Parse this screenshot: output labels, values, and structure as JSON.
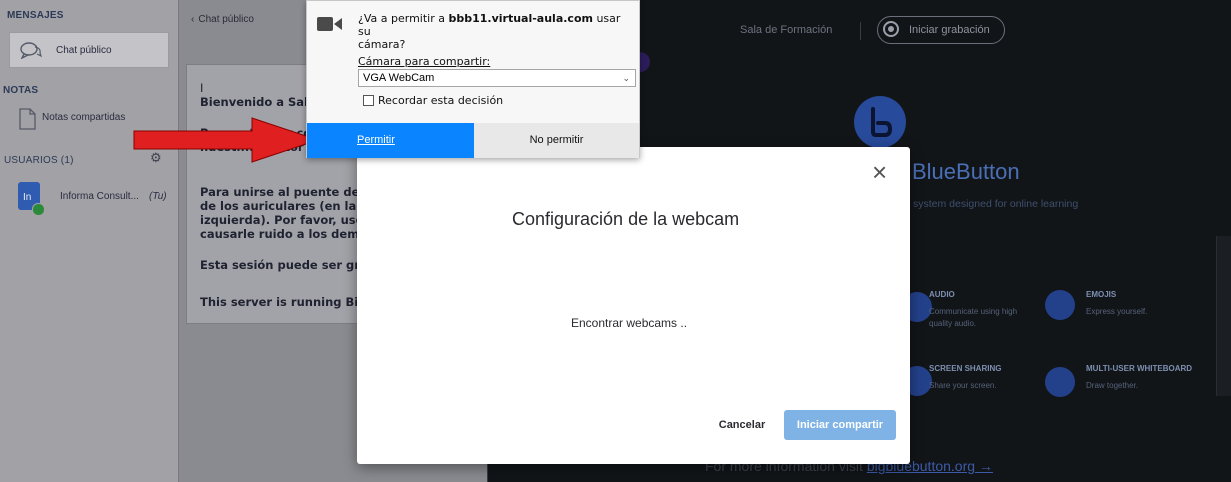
{
  "sidebar": {
    "messages_header": "MENSAJES",
    "chat_item": "Chat público",
    "notes_header": "NOTAS",
    "notes_item": "Notas compartidas",
    "users_header": "USUARIOS (1)",
    "user_name": "Informa Consult...",
    "user_tag": "(Tu)",
    "avatar_initials": "In"
  },
  "chat": {
    "back_label": "Chat público",
    "messages": [
      "I",
      "Bienvenido a Sala d",
      "Para entender com",
      "nuestr... ...tutor",
      "Para unirse al puente de audi",
      "de los auriculares (en la esqu",
      "izquierda). Por favor, use aur",
      "causarle ruido a los demás.",
      "Esta sesión puede ser grabad",
      "This server is running BigBlu"
    ]
  },
  "topbar": {
    "room": "Sala de Formación",
    "record": "Iniciar grabación"
  },
  "permission": {
    "question_pre": "¿Va a permitir a ",
    "domain": "bbb11.virtual-aula.com",
    "question_post": " usar su",
    "question_line2": "cámara?",
    "camera_label": "Cámara para compartir:",
    "camera_value": "VGA WebCam",
    "remember": "Recordar esta decisión",
    "allow": "Permitir",
    "deny": "No permitir"
  },
  "modal": {
    "title": "Configuración de la webcam",
    "status": "Encontrar webcams ..",
    "cancel": "Cancelar",
    "start": "Iniciar compartir",
    "close": "×"
  },
  "bbb": {
    "brand": "BlueButton",
    "tagline": "system designed for online learning",
    "features": [
      {
        "title": "AUDIO",
        "desc1": "Communicate using high",
        "desc2": "quality audio."
      },
      {
        "title": "EMOJIS",
        "desc1": "Express yourself.",
        "desc2": ""
      },
      {
        "title": "SCREEN SHARING",
        "desc1": "Share your screen.",
        "desc2": ""
      },
      {
        "title": "MULTI-USER WHITEBOARD",
        "desc1": "Draw together.",
        "desc2": ""
      }
    ],
    "footer_pre": "For more information visit ",
    "footer_link": "bigbluebutton.org →"
  },
  "colors": {
    "allow_button": "#0a84ff",
    "arrow": "#e02020",
    "start_button": "#7fb3e6"
  }
}
